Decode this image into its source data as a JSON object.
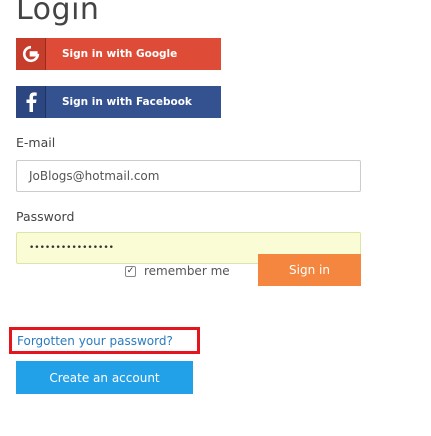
{
  "page": {
    "title": "Login"
  },
  "social": {
    "google": {
      "icon": "google-g-icon",
      "label": "Sign in with Google",
      "color": "#de4b36"
    },
    "facebook": {
      "icon": "facebook-f-icon",
      "label": "Sign in with Facebook",
      "color": "#34528f"
    }
  },
  "form": {
    "email_label": "E-mail",
    "email_value": "JoBlogs@hotmail.com",
    "password_label": "Password",
    "password_value": "••••••••••••••••",
    "remember_label": "remember me",
    "remember_checked": true,
    "signin_label": "Sign in",
    "signin_color": "#f5863f"
  },
  "links": {
    "forgot_password": "Forgotten your password?",
    "create_account": "Create an account",
    "highlight_color": "#e3161d",
    "create_color": "#23a1e8"
  }
}
